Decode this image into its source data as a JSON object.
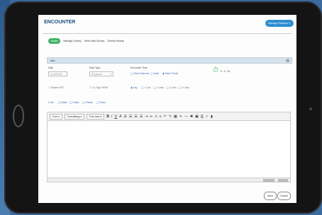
{
  "page": {
    "title": "ENCOUNTER",
    "manage_button": "Manage Reviews"
  },
  "tabs": [
    {
      "label": "Notes"
    },
    {
      "label": "Manage Survey"
    },
    {
      "label": "Send New Survey"
    },
    {
      "label": "Survey History"
    }
  ],
  "panel": {
    "title": "Add"
  },
  "form": {
    "date_label": "Date",
    "date_value": "11/10/2023",
    "note_type_label": "Note Type",
    "note_type_value": "Physician",
    "encounter_time_label": "Encounter Time",
    "time_options": [
      "Time Unknown",
      "Units",
      "Start / Finish"
    ],
    "timer_value": "0 : 0 : 23",
    "check_a": "Billable NPT",
    "check_b": "Co-Sign NPSB",
    "unit_options": [
      "Any",
      "1 Unit",
      "2 Units",
      "3 Units",
      "4 Units"
    ],
    "visibility_options": [
      "All",
      "Make",
      "Public",
      "Private",
      "Team"
    ]
  },
  "editor": {
    "font_label": "Font",
    "format_label": "Formatting",
    "size_label": "Font size",
    "bold": "B",
    "italic": "I",
    "underline": "U",
    "font_color": "A"
  },
  "footer": {
    "save": "Save",
    "cancel": "Cancel"
  }
}
